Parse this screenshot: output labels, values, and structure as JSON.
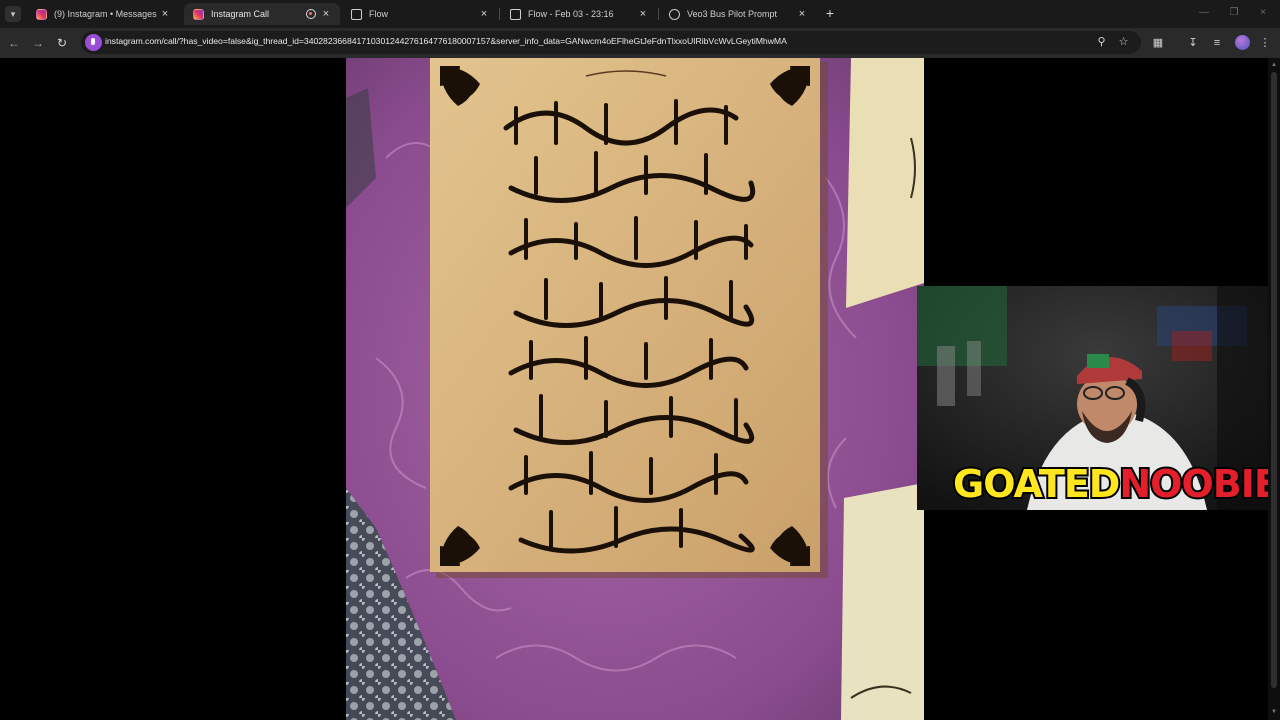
{
  "browser": {
    "tabs": [
      {
        "title": "(9) Instagram • Messages",
        "icon": "instagram-icon",
        "active": false
      },
      {
        "title": "Instagram Call",
        "icon": "instagram-icon",
        "active": true,
        "recording": true
      },
      {
        "title": "Flow",
        "icon": "document-icon",
        "active": false
      },
      {
        "title": "Flow - Feb 03 - 23:16",
        "icon": "document-icon",
        "active": false
      },
      {
        "title": "Veo3 Bus Pilot Prompt",
        "icon": "globe-icon",
        "active": false
      }
    ],
    "url": "instagram.com/call/?has_video=false&ig_thread_id=340282366841710301244276164776180007157&server_info_data=GANwcm4oEFlheGtJeFdnTlxxoUIRibVcWvLGeytiMhwMA",
    "accent": "#9a4ed8"
  },
  "call": {
    "main_video": {
      "subject": "Arabic calligraphy on parchment over purple cloth",
      "colors": {
        "cloth": "#8a4c8e",
        "parchment": "#d9b681",
        "ink": "#1a1008"
      }
    },
    "pip_video": {
      "subject": "streamer with headphones and cap",
      "overlay_logo": {
        "part1": "GOATED",
        "part2": "NOOBIE",
        "color1": "#ffe61f",
        "color2": "#e21f2a"
      }
    }
  }
}
